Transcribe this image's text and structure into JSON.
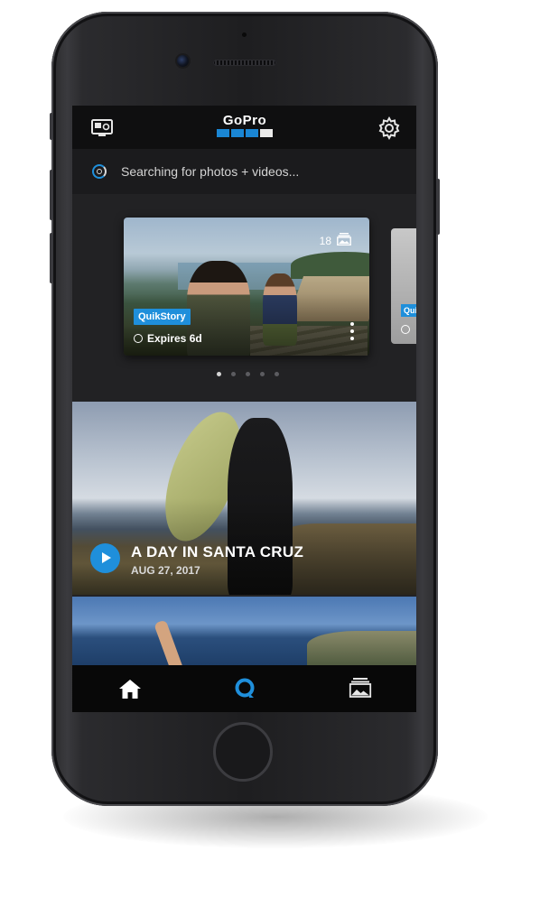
{
  "app": {
    "brand": "GoPro",
    "brand_colors": {
      "accent": "#1f8fdb",
      "header_bg": "#0f0f10",
      "screen_bg": "#222224"
    }
  },
  "header": {
    "left_icon": "camera-icon",
    "right_icon": "gear-icon"
  },
  "status": {
    "icon": "loading-spinner-icon",
    "text": "Searching for photos + videos..."
  },
  "story_card": {
    "count": "18",
    "count_icon": "gallery-stack-icon",
    "badge": "QuikStory",
    "expires": "Expires 6d",
    "menu_icon": "kebab-menu-icon"
  },
  "peek_card": {
    "badge": "Quik"
  },
  "carousel": {
    "page_count": 5,
    "active_index": 0
  },
  "feature": {
    "title": "A DAY IN SANTA CRUZ",
    "date": "AUG 27, 2017",
    "play_icon": "play-icon"
  },
  "tabbar": {
    "items": [
      {
        "icon": "home-icon"
      },
      {
        "icon": "quik-icon"
      },
      {
        "icon": "media-library-icon"
      }
    ]
  }
}
